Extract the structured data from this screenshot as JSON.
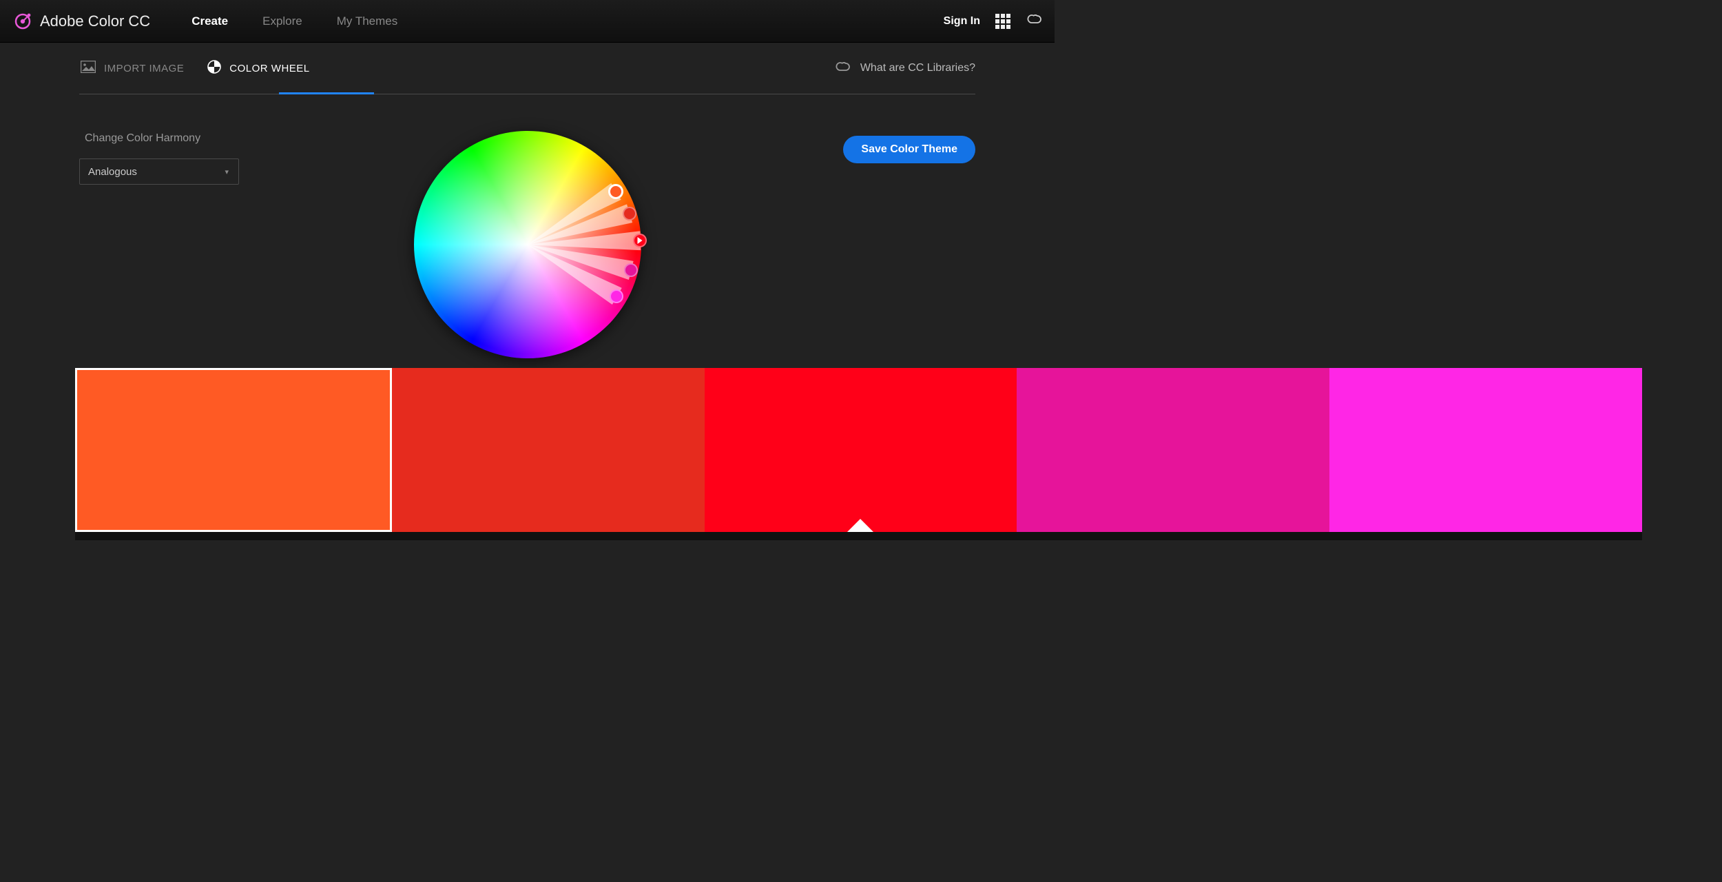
{
  "header": {
    "app_title": "Adobe Color CC",
    "nav": {
      "create": "Create",
      "explore": "Explore",
      "my_themes": "My Themes"
    },
    "signin": "Sign In"
  },
  "tabs": {
    "import_image": "IMPORT IMAGE",
    "color_wheel": "COLOR WHEEL",
    "cc_libraries": "What are CC Libraries?"
  },
  "harmony": {
    "label": "Change Color Harmony",
    "selected": "Analogous"
  },
  "actions": {
    "save": "Save Color Theme"
  },
  "wheel": {
    "handles": [
      {
        "angle_deg": -31,
        "radius": 150,
        "color": "#ff5a24",
        "role": "main"
      },
      {
        "angle_deg": -17,
        "radius": 155,
        "color": "#e62b1e",
        "role": "normal"
      },
      {
        "angle_deg": -2,
        "radius": 164,
        "color": "#ff0018",
        "role": "base"
      },
      {
        "angle_deg": 14,
        "radius": 155,
        "color": "#e6149a",
        "role": "normal"
      },
      {
        "angle_deg": 30,
        "radius": 150,
        "color": "#ff26e6",
        "role": "normal"
      }
    ]
  },
  "swatches": [
    {
      "hex": "#ff5a24",
      "selected": true,
      "base": false
    },
    {
      "hex": "#e62b1e",
      "selected": false,
      "base": false
    },
    {
      "hex": "#ff0018",
      "selected": false,
      "base": true
    },
    {
      "hex": "#e6149a",
      "selected": false,
      "base": false
    },
    {
      "hex": "#ff26e6",
      "selected": false,
      "base": false
    }
  ]
}
